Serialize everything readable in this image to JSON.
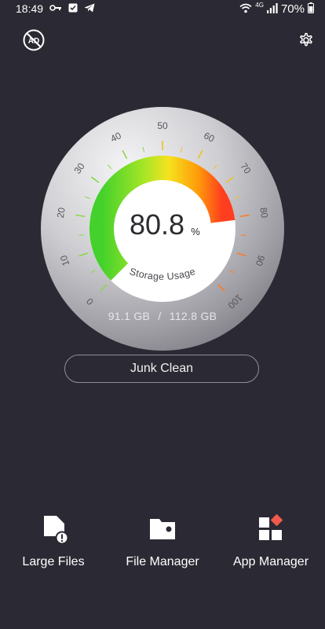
{
  "status_bar": {
    "time": "18:49",
    "network": "4G",
    "battery": "70%"
  },
  "header": {
    "left_icon": "no-ads-icon",
    "left_icon_text": "AD",
    "right_icon": "settings-gear-icon"
  },
  "gauge": {
    "percent_value": "80.8",
    "percent_unit": "%",
    "label": "Storage Usage",
    "scale_labels": [
      "0",
      "10",
      "20",
      "30",
      "40",
      "50",
      "60",
      "70",
      "80",
      "90",
      "100"
    ],
    "fill_fraction": 0.808
  },
  "storage": {
    "used": "91.1 GB",
    "separator": "/",
    "total": "112.8 GB"
  },
  "junk_clean_label": "Junk Clean",
  "tools": [
    {
      "label": "Large Files",
      "icon": "large-files-icon"
    },
    {
      "label": "File Manager",
      "icon": "folder-icon"
    },
    {
      "label": "App Manager",
      "icon": "app-grid-icon"
    }
  ],
  "colors": {
    "background": "#2b2933",
    "gauge_green": "#44d12c",
    "gauge_yellow": "#f6e21e",
    "gauge_orange": "#ff8a00",
    "gauge_red": "#ff3d1f"
  }
}
